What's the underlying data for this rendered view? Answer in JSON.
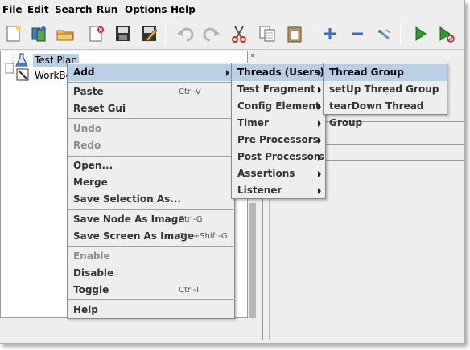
{
  "menubar": {
    "items": [
      {
        "label": "File",
        "mnemonic": "F"
      },
      {
        "label": "Edit",
        "mnemonic": "E"
      },
      {
        "label": "Search",
        "mnemonic": "S"
      },
      {
        "label": "Run",
        "mnemonic": "R"
      },
      {
        "label": "Options",
        "mnemonic": "O"
      },
      {
        "label": "Help",
        "mnemonic": "H"
      }
    ]
  },
  "toolbar": {
    "icons": [
      "new-icon",
      "templates-icon",
      "open-icon",
      "close-icon",
      "save-icon",
      "save-as-icon",
      "undo-icon",
      "redo-icon",
      "cut-icon",
      "copy-icon",
      "paste-icon",
      "expand-icon",
      "collapse-icon",
      "toggle-icon",
      "start-icon",
      "start-no-pause-icon"
    ]
  },
  "tree": {
    "items": [
      {
        "label": "Test Plan",
        "icon": "beaker-icon",
        "selected": true
      },
      {
        "label": "WorkBench",
        "icon": "workbench-icon",
        "selected": false
      }
    ]
  },
  "context_menu": {
    "items": [
      {
        "label": "Add",
        "accel": "",
        "enabled": true,
        "submenu": true,
        "highlighted": true
      },
      {
        "label": "Paste",
        "accel": "Ctrl-V",
        "enabled": true
      },
      {
        "label": "Reset Gui",
        "accel": "",
        "enabled": true
      },
      {
        "label": "Undo",
        "accel": "",
        "enabled": false
      },
      {
        "label": "Redo",
        "accel": "",
        "enabled": false
      },
      {
        "label": "Open...",
        "accel": "",
        "enabled": true
      },
      {
        "label": "Merge",
        "accel": "",
        "enabled": true
      },
      {
        "label": "Save Selection As...",
        "accel": "",
        "enabled": true
      },
      {
        "label": "Save Node As Image",
        "accel": "Ctrl-G",
        "enabled": true
      },
      {
        "label": "Save Screen As Image",
        "accel": "Ctrl+Shift-G",
        "enabled": true
      },
      {
        "label": "Enable",
        "accel": "",
        "enabled": false
      },
      {
        "label": "Disable",
        "accel": "",
        "enabled": true
      },
      {
        "label": "Toggle",
        "accel": "Ctrl-T",
        "enabled": true
      },
      {
        "label": "Help",
        "accel": "",
        "enabled": true
      }
    ]
  },
  "add_submenu": {
    "items": [
      {
        "label": "Threads (Users)",
        "submenu": true,
        "highlighted": true
      },
      {
        "label": "Test Fragment",
        "submenu": true
      },
      {
        "label": "Config Element",
        "submenu": true
      },
      {
        "label": "Timer",
        "submenu": true
      },
      {
        "label": "Pre Processors",
        "submenu": true
      },
      {
        "label": "Post Processors",
        "submenu": true
      },
      {
        "label": "Assertions",
        "submenu": true
      },
      {
        "label": "Listener",
        "submenu": true
      }
    ]
  },
  "threads_submenu": {
    "items": [
      {
        "label": "Thread Group",
        "highlighted": true
      },
      {
        "label": "setUp Thread Group"
      },
      {
        "label": "tearDown Thread Group"
      }
    ]
  },
  "colors": {
    "menu_background": "#eeeeee",
    "highlight": "#b8cfe5",
    "disabled_text": "#8c8c8c",
    "tree_background": "#ffffff"
  }
}
